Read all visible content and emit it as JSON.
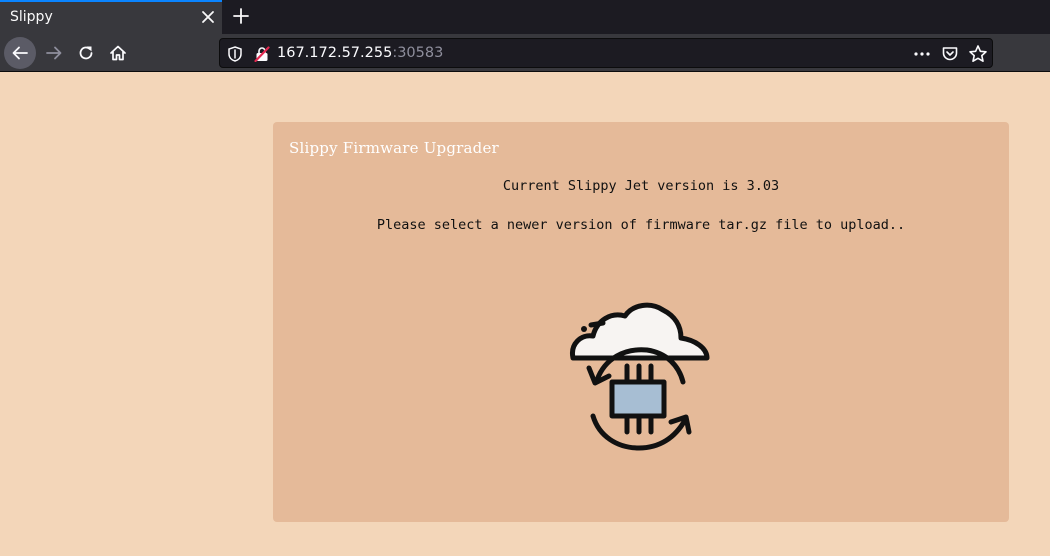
{
  "browser": {
    "tab_title": "Slippy",
    "url_host": "167.172.57.255",
    "url_port": ":30583"
  },
  "page": {
    "card_title": "Slippy Firmware Upgrader",
    "version_text": "Current Slippy Jet version is 3.03",
    "instruction_text": "Please select a newer version of firmware tar.gz file to upload.."
  },
  "icons": {
    "back": "arrow-left-icon",
    "forward": "arrow-right-icon",
    "reload": "reload-icon",
    "home": "home-icon",
    "shield": "tracking-shield-icon",
    "insecure": "insecure-lock-icon",
    "more": "more-dots-icon",
    "pocket": "pocket-icon",
    "bookmark": "star-icon",
    "illustration": "cloud-firmware-upload-icon"
  },
  "colors": {
    "page_background": "#f3d6b9",
    "card_background": "#e5ba99",
    "chip_fill": "#a7bed3",
    "cloud_fill": "#f7f4f2"
  }
}
